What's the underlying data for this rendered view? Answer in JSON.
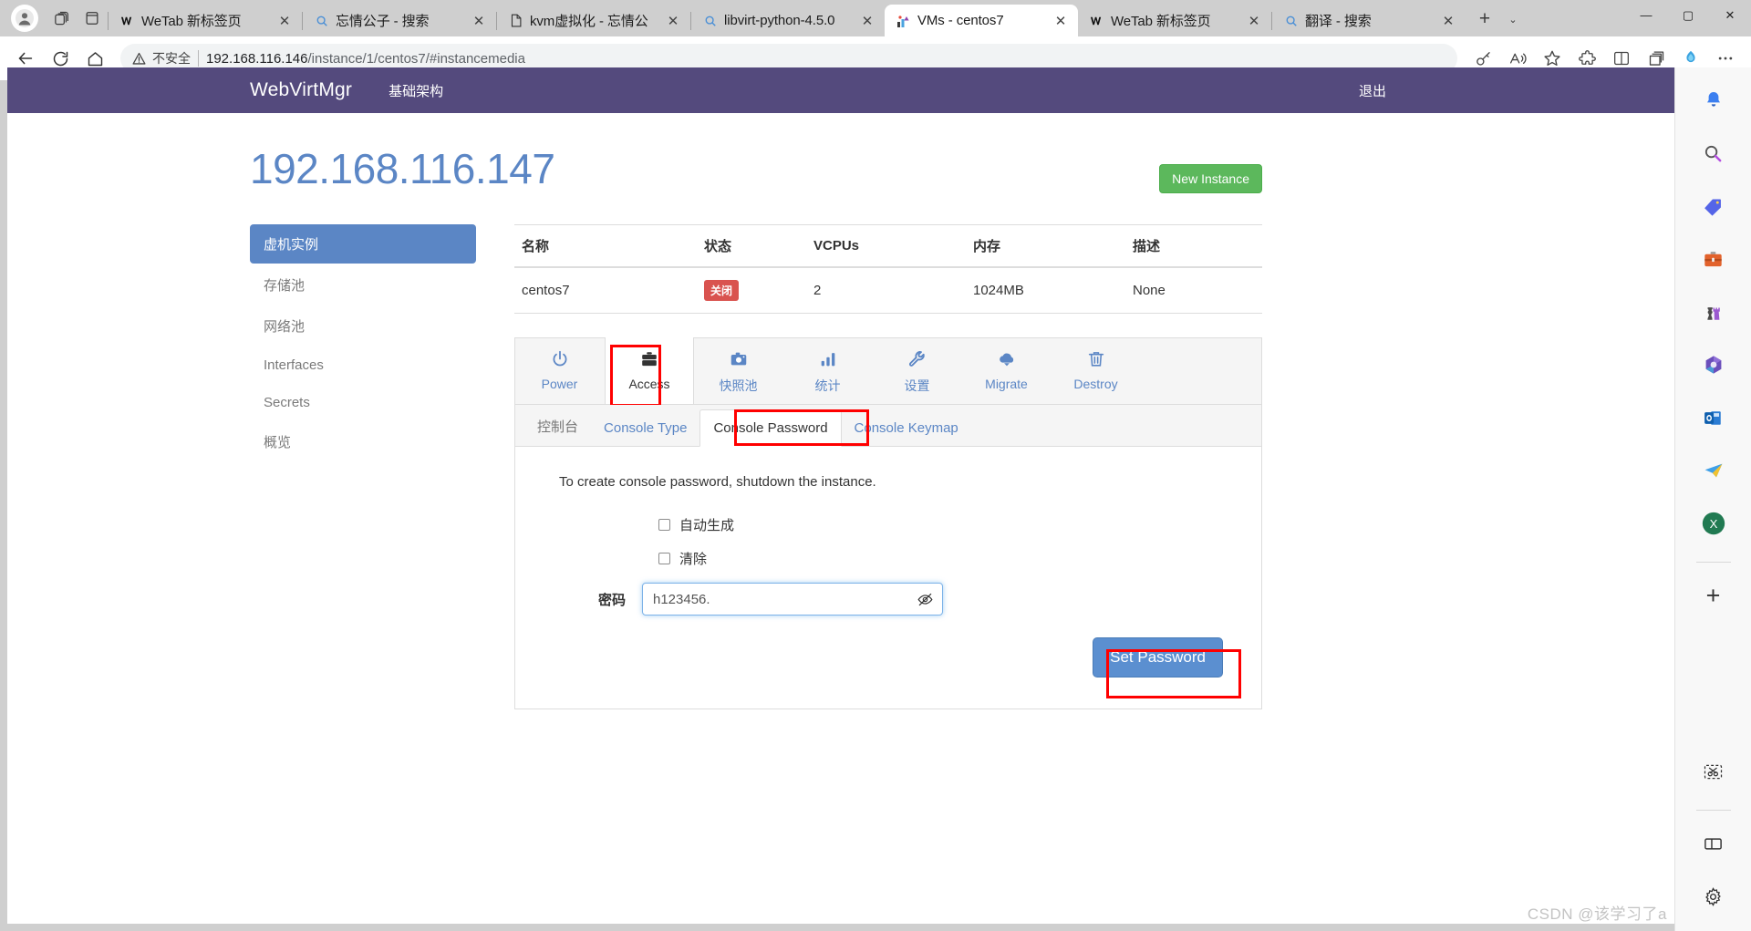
{
  "browser": {
    "profile_icon": "account-icon",
    "collections_icon": "collections-icon",
    "split_icon": "tab-panel-icon",
    "tabs": [
      {
        "title": "WeTab 新标签页",
        "favicon": "wetab-icon",
        "active": false
      },
      {
        "title": "忘情公子 - 搜索",
        "favicon": "search-icon",
        "active": false
      },
      {
        "title": "kvm虚拟化 - 忘情公",
        "favicon": "page-icon",
        "active": false
      },
      {
        "title": "libvirt-python-4.5.0",
        "favicon": "search-icon",
        "active": false
      },
      {
        "title": "VMs - centos7",
        "favicon": "webvirtmgr-icon",
        "active": true
      },
      {
        "title": "WeTab 新标签页",
        "favicon": "wetab-icon",
        "active": false
      },
      {
        "title": "翻译 - 搜索",
        "favicon": "search-icon",
        "active": false
      }
    ],
    "new_tab_label": "+",
    "tab_list_label": "⌄",
    "window_controls": {
      "minimize": "—",
      "maximize": "▢",
      "close": "✕"
    },
    "toolbar": {
      "back_icon": "back-arrow-icon",
      "reload_icon": "reload-icon",
      "home_icon": "home-icon",
      "security_label": "不安全",
      "url_host": "192.168.116.146",
      "url_path": "/instance/1/centos7/#instancemedia",
      "key_icon": "key-icon",
      "read_aloud_icon": "read-aloud-icon",
      "favorite_icon": "star-icon",
      "extensions_icon": "extensions-icon",
      "split_screen_icon": "split-screen-icon",
      "collections_icon": "collections-icon",
      "browser_essentials_icon": "browser-essentials-icon",
      "settings_icon": "more-options-icon"
    }
  },
  "wvm": {
    "brand": "WebVirtMgr",
    "nav_link": "基础架构",
    "logout": "退出",
    "page_title": "192.168.116.147",
    "new_instance_button": "New Instance",
    "sidebar": {
      "items": [
        {
          "label": "虚机实例",
          "active": true
        },
        {
          "label": "存储池",
          "active": false
        },
        {
          "label": "网络池",
          "active": false
        },
        {
          "label": "Interfaces",
          "active": false
        },
        {
          "label": "Secrets",
          "active": false
        },
        {
          "label": "概览",
          "active": false
        }
      ]
    },
    "instance_table": {
      "headers": [
        "名称",
        "状态",
        "VCPUs",
        "内存",
        "描述"
      ],
      "rows": [
        {
          "name": "centos7",
          "state": "关闭",
          "vcpus": "2",
          "memory": "1024MB",
          "description": "None"
        }
      ]
    },
    "icon_tabs": [
      {
        "label": "Power",
        "icon": "power-icon",
        "active": false
      },
      {
        "label": "Access",
        "icon": "briefcase-icon",
        "active": true
      },
      {
        "label": "快照池",
        "icon": "camera-icon",
        "active": false
      },
      {
        "label": "统计",
        "icon": "bar-chart-icon",
        "active": false
      },
      {
        "label": "设置",
        "icon": "wrench-icon",
        "active": false
      },
      {
        "label": "Migrate",
        "icon": "cloud-download-icon",
        "active": false
      },
      {
        "label": "Destroy",
        "icon": "trash-icon",
        "active": false
      }
    ],
    "sub_tabs": [
      {
        "label": "控制台",
        "active": false,
        "muted": true
      },
      {
        "label": "Console Type",
        "active": false,
        "muted": false
      },
      {
        "label": "Console Password",
        "active": true,
        "muted": false
      },
      {
        "label": "Console Keymap",
        "active": false,
        "muted": false
      }
    ],
    "panel": {
      "note": "To create console password, shutdown the instance.",
      "checkboxes": [
        {
          "label": "自动生成",
          "checked": false
        },
        {
          "label": "清除",
          "checked": false
        }
      ],
      "password_label": "密码",
      "password_value": "h123456.",
      "password_placeholder": "",
      "toggle_visibility_icon": "eye-off-icon",
      "submit_label": "Set Password"
    },
    "colors": {
      "nav_purple": "#544a7d",
      "title_blue": "#5b86c5",
      "green_button": "#5cb85c",
      "blue_button": "#5b8fd0",
      "danger_badge": "#d9534f",
      "annotation_red": "#ff0000"
    }
  },
  "edge_sidebar": {
    "items": [
      {
        "icon": "bell-icon",
        "glyph": "🔔"
      },
      {
        "icon": "search-icon",
        "glyph": "🔍"
      },
      {
        "icon": "tag-icon",
        "glyph": "🏷"
      },
      {
        "icon": "briefcase-icon",
        "glyph": "🧰"
      },
      {
        "icon": "games-icon",
        "glyph": "♟"
      },
      {
        "icon": "microsoft365-icon",
        "glyph": "◈"
      },
      {
        "icon": "outlook-icon",
        "glyph": "📧"
      },
      {
        "icon": "telegram-icon",
        "glyph": "✈"
      },
      {
        "icon": "excel-icon",
        "glyph": "X"
      }
    ],
    "add_label": "+",
    "bottom_items": [
      {
        "icon": "screenshot-icon"
      },
      {
        "icon": "split-screen-icon"
      },
      {
        "icon": "settings-gear-icon"
      }
    ]
  },
  "watermark": "CSDN @该学习了a"
}
